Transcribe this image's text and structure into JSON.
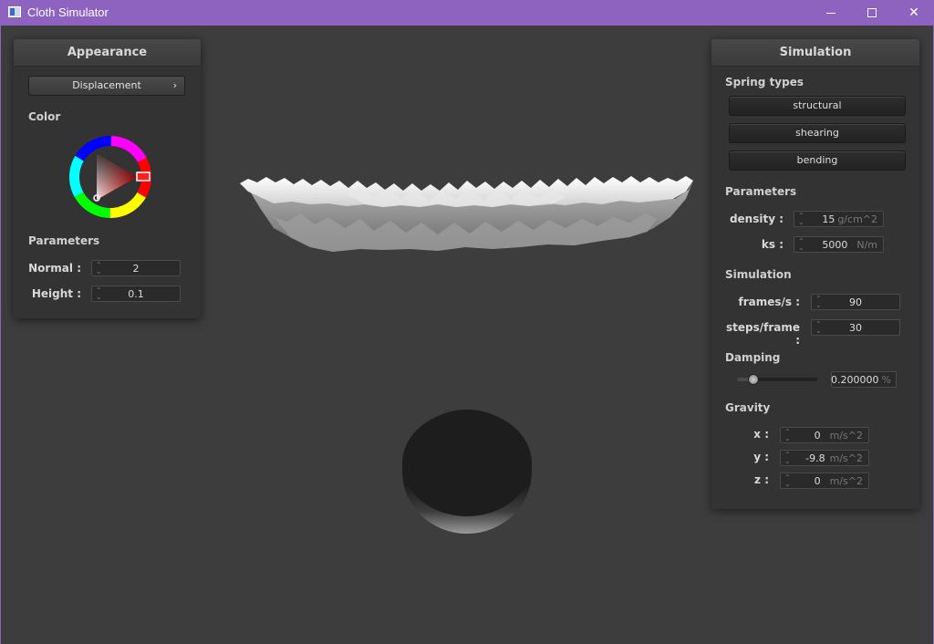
{
  "window": {
    "title": "Cloth Simulator"
  },
  "appearance": {
    "title": "Appearance",
    "shader_button": "Displacement",
    "color_label": "Color",
    "selected_color": "#ff0000",
    "params_label": "Parameters",
    "normal": {
      "label": "Normal :",
      "value": "2"
    },
    "height": {
      "label": "Height :",
      "value": "0.1"
    }
  },
  "simulation": {
    "title": "Simulation",
    "spring_label": "Spring types",
    "spring_types": [
      "structural",
      "shearing",
      "bending"
    ],
    "params_label": "Parameters",
    "density": {
      "label": "density :",
      "value": "15",
      "unit": "g/cm^2"
    },
    "ks": {
      "label": "ks :",
      "value": "5000",
      "unit": "N/m"
    },
    "sim_label": "Simulation",
    "fps": {
      "label": "frames/s :",
      "value": "90"
    },
    "steps": {
      "label": "steps/frame :",
      "value": "30"
    },
    "damping_label": "Damping",
    "damping": {
      "value": "0.200000",
      "unit": "%",
      "slider_fraction": 0.2
    },
    "gravity_label": "Gravity",
    "gx": {
      "label": "x :",
      "value": "0",
      "unit": "m/s^2"
    },
    "gy": {
      "label": "y :",
      "value": "-9.8",
      "unit": "m/s^2"
    },
    "gz": {
      "label": "z :",
      "value": "0",
      "unit": "m/s^2"
    }
  },
  "icons": {
    "app": "app-icon",
    "minimize": "minimize-icon",
    "maximize": "maximize-icon",
    "close": "close-icon",
    "chevron": "chevron-right-icon",
    "spinner": "spinner-arrows-icon"
  }
}
